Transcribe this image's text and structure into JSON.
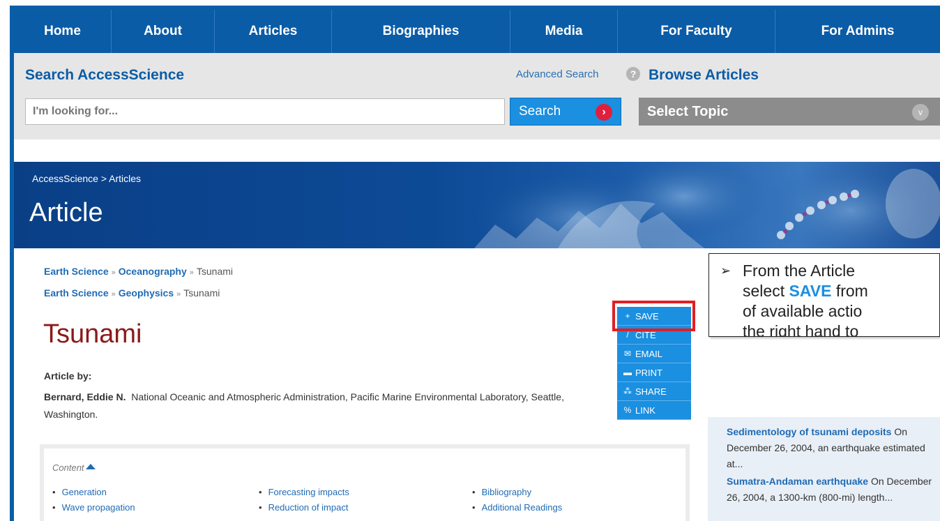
{
  "nav": {
    "items": [
      {
        "label": "Home"
      },
      {
        "label": "About"
      },
      {
        "label": "Articles"
      },
      {
        "label": "Biographies"
      },
      {
        "label": "Media"
      },
      {
        "label": "For Faculty"
      },
      {
        "label": "For Admins"
      }
    ]
  },
  "search": {
    "title": "Search AccessScience",
    "advanced_label": "Advanced Search",
    "help_glyph": "?",
    "placeholder": "I'm looking for...",
    "button_label": "Search",
    "button_glyph": "›"
  },
  "browse": {
    "title": "Browse Articles",
    "select_value": "Select Topic",
    "chevron_glyph": "v"
  },
  "hero": {
    "breadcrumb": "AccessScience > Articles",
    "title": "Article"
  },
  "article": {
    "topic_paths": [
      [
        "Earth Science",
        "Oceanography",
        "Tsunami"
      ],
      [
        "Earth Science",
        "Geophysics",
        "Tsunami"
      ]
    ],
    "path_separator": "»",
    "title": "Tsunami",
    "by_label": "Article by:",
    "author_name": "Bernard, Eddie N.",
    "author_affiliation": "National Oceanic and Atmospheric Administration, Pacific Marine Environmental Laboratory, Seattle, Washington."
  },
  "actions": [
    {
      "icon": "plus-icon",
      "glyph": "+",
      "label": "SAVE"
    },
    {
      "icon": "quote-icon",
      "glyph": "/",
      "label": "CITE"
    },
    {
      "icon": "envelope-icon",
      "glyph": "✉",
      "label": "EMAIL"
    },
    {
      "icon": "printer-icon",
      "glyph": "▬",
      "label": "PRINT"
    },
    {
      "icon": "share-icon",
      "glyph": "⁂",
      "label": "SHARE"
    },
    {
      "icon": "link-icon",
      "glyph": "%",
      "label": "LINK"
    }
  ],
  "callout": {
    "bullet": "➢",
    "text_before": "From the Article",
    "text_mid_1": "select",
    "highlight": "SAVE",
    "text_mid_2": "from",
    "text_line_3": "of available actio",
    "text_line_4": "the right hand to"
  },
  "related": [
    {
      "title": "Sedimentology of tsunami deposits",
      "snippet": "On December 26, 2004, an earthquake estimated at..."
    },
    {
      "title": "Sumatra-Andaman earthquake",
      "snippet": "On December 26, 2004, a 1300-km (800-mi) length..."
    }
  ],
  "contents": {
    "heading": "Content",
    "columns": [
      [
        "Generation",
        "Wave propagation"
      ],
      [
        "Forecasting impacts",
        "Reduction of impact"
      ],
      [
        "Bibliography",
        "Additional Readings"
      ]
    ]
  },
  "colors": {
    "brand_blue": "#0b5ca6",
    "action_blue": "#1b8fe0",
    "title_red": "#8b1a1a",
    "highlight_red": "#e01f26"
  }
}
